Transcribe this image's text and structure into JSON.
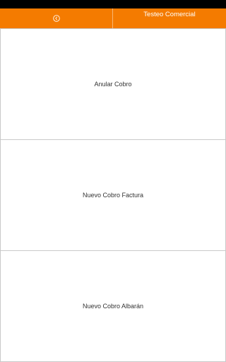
{
  "header": {
    "title": "Testeo Comercial",
    "back_icon": "back-circle-icon",
    "accent_color": "#f47b00"
  },
  "menu": {
    "items": [
      {
        "label": "Anular Cobro"
      },
      {
        "label": "Nuevo Cobro Factura"
      },
      {
        "label": "Nuevo Cobro Albarán"
      }
    ]
  }
}
